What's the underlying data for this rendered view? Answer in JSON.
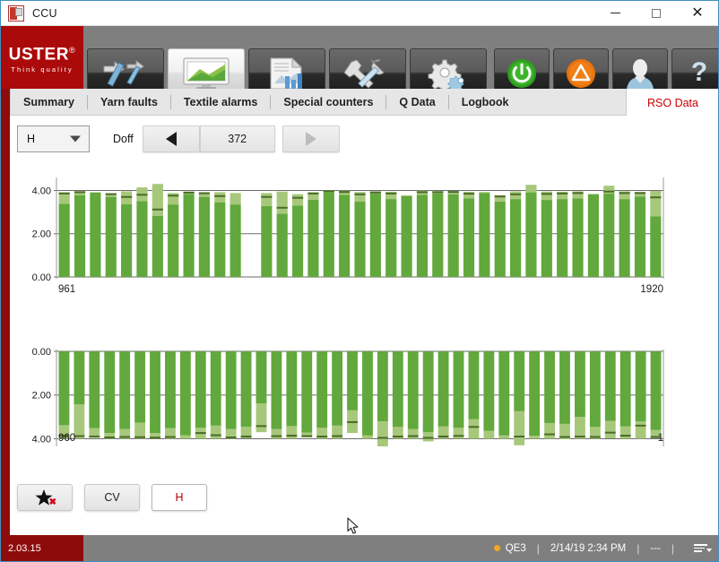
{
  "window": {
    "title": "CCU",
    "icon": "app-icon",
    "minimize": "—",
    "maximize": "☐",
    "close": "✕"
  },
  "brand": {
    "name": "USTER",
    "registered": "®",
    "tagline": "Think quality"
  },
  "toolbar": {
    "left_buttons": [
      {
        "name": "machine-setup-icon",
        "label": "Machine setup"
      },
      {
        "name": "monitor-chart-icon",
        "label": "Monitoring",
        "active": true
      },
      {
        "name": "reports-icon",
        "label": "Reports"
      },
      {
        "name": "tools-icon",
        "label": "Tools"
      },
      {
        "name": "settings-gears-icon",
        "label": "Settings"
      }
    ],
    "right_buttons": [
      {
        "name": "power-icon",
        "label": "Power"
      },
      {
        "name": "alarm-warning-icon",
        "label": "Alarms"
      },
      {
        "name": "user-icon",
        "label": "User"
      },
      {
        "name": "help-icon",
        "label": "Help"
      }
    ]
  },
  "tabs": {
    "items": [
      {
        "label": "Summary"
      },
      {
        "label": "Yarn faults"
      },
      {
        "label": "Textile alarms"
      },
      {
        "label": "Special counters"
      },
      {
        "label": "Q Data"
      },
      {
        "label": "Logbook"
      }
    ],
    "active": {
      "label": "RSO Data",
      "color": "#cc0000"
    }
  },
  "controls": {
    "view_select": {
      "value": "H",
      "options": [
        "H",
        "CV"
      ]
    },
    "doff_label": "Doff",
    "prev_label": "◀",
    "doff_value": "372",
    "next_label": "▶"
  },
  "bottom_buttons": [
    {
      "name": "favorite-button",
      "label": "",
      "icon": "star-x-icon"
    },
    {
      "name": "cv-button",
      "label": "CV"
    },
    {
      "name": "h-button",
      "label": "H",
      "selected": true
    }
  ],
  "status": {
    "version": "2.03.15",
    "quality_indicator": "QE3",
    "indicator_color": "#f5a623",
    "timestamp": "2/14/19 2:34 PM",
    "extra": "---",
    "menu_icon": "list-menu-icon"
  },
  "chart_data": [
    {
      "id": "upper",
      "type": "bar",
      "title": "",
      "xlabel": "",
      "ylabel": "",
      "orientation": "up",
      "ylim": [
        0,
        4.6
      ],
      "yticks": [
        0.0,
        2.0,
        4.0
      ],
      "ytick_labels": [
        "0.00",
        "2.00",
        "4.00"
      ],
      "x_start_label": "961",
      "x_end_label": "1920",
      "grid": true,
      "colors": {
        "body": "#62a83c",
        "upper": "#a7c87a",
        "marker": "#4a6b2a"
      },
      "bars": [
        {
          "body": 3.38,
          "top": 3.92,
          "marker": 3.86
        },
        {
          "body": 3.78,
          "top": 3.97,
          "marker": 3.92
        },
        {
          "body": 3.91,
          "top": 3.91,
          "marker": null
        },
        {
          "body": 3.7,
          "top": 3.87,
          "marker": 3.83
        },
        {
          "body": 3.36,
          "top": 3.96,
          "marker": 3.7
        },
        {
          "body": 3.5,
          "top": 4.14,
          "marker": 3.8
        },
        {
          "body": 2.82,
          "top": 4.3,
          "marker": 3.12
        },
        {
          "body": 3.35,
          "top": 3.88,
          "marker": 3.76
        },
        {
          "body": 3.83,
          "top": 3.95,
          "marker": 3.9
        },
        {
          "body": 3.7,
          "top": 3.92,
          "marker": 3.87
        },
        {
          "body": 3.45,
          "top": 3.92,
          "marker": 3.74
        },
        {
          "body": 3.35,
          "top": 3.88,
          "marker": null
        },
        {
          "body": null,
          "top": null,
          "marker": null
        },
        {
          "body": 3.28,
          "top": 3.88,
          "marker": 3.7
        },
        {
          "body": 2.92,
          "top": 3.95,
          "marker": 3.2
        },
        {
          "body": 3.3,
          "top": 3.83,
          "marker": 3.66
        },
        {
          "body": 3.57,
          "top": 3.92,
          "marker": 3.86
        },
        {
          "body": 3.92,
          "top": 4.02,
          "marker": 3.97
        },
        {
          "body": 3.79,
          "top": 3.99,
          "marker": 3.93
        },
        {
          "body": 3.48,
          "top": 3.93,
          "marker": 3.82
        },
        {
          "body": 3.86,
          "top": 3.96,
          "marker": 3.91
        },
        {
          "body": 3.6,
          "top": 3.94,
          "marker": 3.86
        },
        {
          "body": 3.74,
          "top": 3.78,
          "marker": null
        },
        {
          "body": 3.79,
          "top": 3.99,
          "marker": 3.92
        },
        {
          "body": 3.86,
          "top": 3.97,
          "marker": 3.92
        },
        {
          "body": 3.82,
          "top": 3.97,
          "marker": 3.93
        },
        {
          "body": 3.63,
          "top": 3.94,
          "marker": 3.85
        },
        {
          "body": 3.88,
          "top": 3.93,
          "marker": null
        },
        {
          "body": 3.48,
          "top": 3.78,
          "marker": 3.72
        },
        {
          "body": 3.6,
          "top": 3.96,
          "marker": 3.82
        },
        {
          "body": 3.91,
          "top": 4.26,
          "marker": null
        },
        {
          "body": 3.56,
          "top": 3.95,
          "marker": 3.84
        },
        {
          "body": 3.6,
          "top": 3.94,
          "marker": 3.86
        },
        {
          "body": 3.63,
          "top": 3.96,
          "marker": 3.88
        },
        {
          "body": 3.83,
          "top": 3.83,
          "marker": null
        },
        {
          "body": 3.85,
          "top": 4.22,
          "marker": 3.95
        },
        {
          "body": 3.6,
          "top": 3.96,
          "marker": 3.88
        },
        {
          "body": 3.72,
          "top": 3.93,
          "marker": 3.88
        },
        {
          "body": 2.8,
          "top": 3.98,
          "marker": 3.68
        }
      ]
    },
    {
      "id": "lower",
      "type": "bar",
      "title": "",
      "orientation": "down",
      "ylim": [
        0,
        4.35
      ],
      "yticks": [
        0.0,
        2.0,
        4.0
      ],
      "ytick_labels": [
        "0.00",
        "2.00",
        "4.00"
      ],
      "x_start_label": "960",
      "x_end_label": "1",
      "grid": true,
      "colors": {
        "body": "#62a83c",
        "upper": "#a7c87a",
        "marker": "#4a6b2a"
      },
      "bars": [
        {
          "body": 3.38,
          "top": 4.0,
          "marker": 3.86
        },
        {
          "body": 2.42,
          "top": 4.0,
          "marker": 3.88
        },
        {
          "body": 3.52,
          "top": 3.96,
          "marker": 3.9
        },
        {
          "body": 3.74,
          "top": 4.0,
          "marker": 3.94
        },
        {
          "body": 3.55,
          "top": 4.0,
          "marker": 3.92
        },
        {
          "body": 3.26,
          "top": 4.0,
          "marker": 3.93
        },
        {
          "body": 3.74,
          "top": 4.0,
          "marker": 3.95
        },
        {
          "body": 3.52,
          "top": 4.0,
          "marker": 3.92
        },
        {
          "body": 3.84,
          "top": 4.0,
          "marker": null
        },
        {
          "body": 3.5,
          "top": 4.0,
          "marker": 3.74
        },
        {
          "body": 3.4,
          "top": 4.0,
          "marker": 3.84
        },
        {
          "body": 3.56,
          "top": 4.0,
          "marker": 3.94
        },
        {
          "body": 3.45,
          "top": 3.98,
          "marker": 3.9
        },
        {
          "body": 2.38,
          "top": 3.7,
          "marker": 3.42
        },
        {
          "body": 3.56,
          "top": 4.0,
          "marker": 3.88
        },
        {
          "body": 3.42,
          "top": 4.0,
          "marker": 3.86
        },
        {
          "body": 3.72,
          "top": 3.94,
          "marker": 3.88
        },
        {
          "body": 3.5,
          "top": 4.0,
          "marker": 3.9
        },
        {
          "body": 3.4,
          "top": 4.0,
          "marker": 3.88
        },
        {
          "body": 2.7,
          "top": 3.74,
          "marker": 3.24
        },
        {
          "body": 3.85,
          "top": 4.0,
          "marker": null
        },
        {
          "body": 3.2,
          "top": 4.35,
          "marker": 3.96
        },
        {
          "body": 3.46,
          "top": 4.0,
          "marker": 3.9
        },
        {
          "body": 3.55,
          "top": 4.0,
          "marker": 3.88
        },
        {
          "body": 3.7,
          "top": 4.12,
          "marker": 3.96
        },
        {
          "body": 3.44,
          "top": 4.0,
          "marker": 3.9
        },
        {
          "body": 3.5,
          "top": 4.0,
          "marker": 3.87
        },
        {
          "body": 3.1,
          "top": 4.0,
          "marker": 3.46
        },
        {
          "body": 3.64,
          "top": 4.0,
          "marker": null
        },
        {
          "body": 3.85,
          "top": 4.0,
          "marker": null
        },
        {
          "body": 2.74,
          "top": 4.3,
          "marker": 3.9
        },
        {
          "body": 3.86,
          "top": 4.0,
          "marker": null
        },
        {
          "body": 3.28,
          "top": 4.0,
          "marker": 3.8
        },
        {
          "body": 3.32,
          "top": 4.02,
          "marker": 3.92
        },
        {
          "body": 3.0,
          "top": 4.0,
          "marker": 3.9
        },
        {
          "body": 3.46,
          "top": 4.0,
          "marker": 3.92
        },
        {
          "body": 3.18,
          "top": 3.98,
          "marker": 3.72
        },
        {
          "body": 3.44,
          "top": 4.0,
          "marker": 3.86
        },
        {
          "body": 3.2,
          "top": 4.0,
          "marker": 3.4
        },
        {
          "body": 3.6,
          "top": 3.98,
          "marker": 3.92
        }
      ]
    }
  ]
}
